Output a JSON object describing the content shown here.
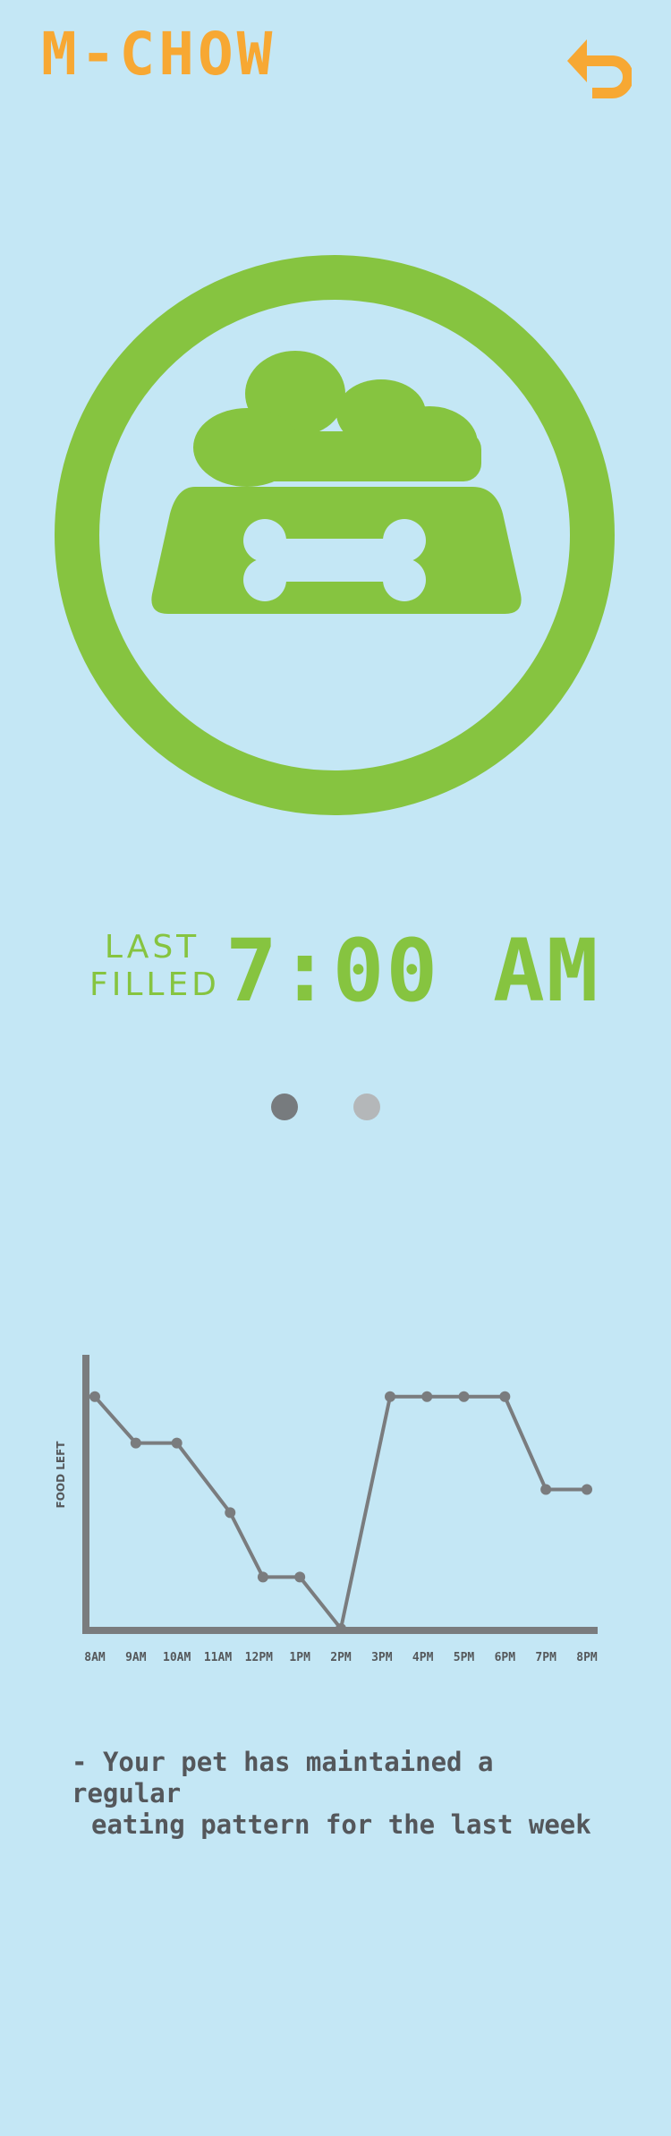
{
  "header": {
    "app_title": "M-CHOW",
    "back_icon": "undo-arrow-icon"
  },
  "hero": {
    "icon": "pet-food-bowl-icon",
    "accent_color": "#86c440"
  },
  "last_filled": {
    "label_line1": "LAST",
    "label_line2": "FILLED",
    "time": "7:00 AM"
  },
  "pager": {
    "pages": 2,
    "active_index": 0
  },
  "chart_data": {
    "type": "line",
    "ylabel": "FOOD LEFT",
    "xlabel": "",
    "categories": [
      "8AM",
      "9AM",
      "10AM",
      "11AM",
      "12PM",
      "1PM",
      "2PM",
      "3PM",
      "4PM",
      "5PM",
      "6PM",
      "7PM",
      "8PM"
    ],
    "points": [
      {
        "x": 8.0,
        "y": 0.9
      },
      {
        "x": 9.0,
        "y": 0.72
      },
      {
        "x": 10.0,
        "y": 0.72
      },
      {
        "x": 11.3,
        "y": 0.45
      },
      {
        "x": 12.1,
        "y": 0.2
      },
      {
        "x": 13.0,
        "y": 0.2
      },
      {
        "x": 14.0,
        "y": 0.0
      },
      {
        "x": 15.2,
        "y": 0.9
      },
      {
        "x": 16.1,
        "y": 0.9
      },
      {
        "x": 17.0,
        "y": 0.9
      },
      {
        "x": 18.0,
        "y": 0.9
      },
      {
        "x": 19.0,
        "y": 0.54
      },
      {
        "x": 20.0,
        "y": 0.54
      }
    ],
    "xlim": [
      8,
      20
    ],
    "ylim": [
      0,
      1
    ],
    "line_color": "#7a7c7e",
    "axis_color": "#7a7c7e"
  },
  "insight": {
    "prefix": "-",
    "line1": "Your pet has maintained a regular",
    "line2": "eating pattern for the last week"
  }
}
